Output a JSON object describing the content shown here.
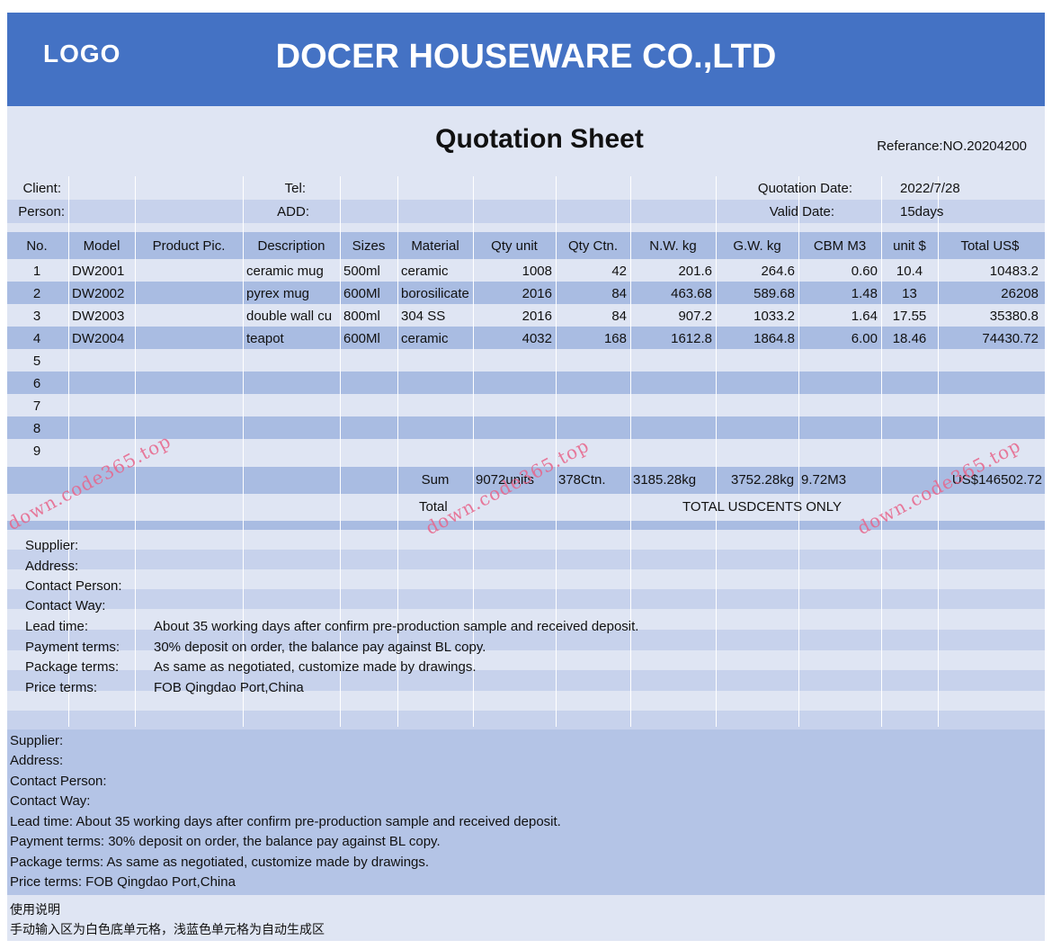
{
  "header": {
    "logo": "LOGO",
    "company": "DOCER HOUSEWARE CO.,LTD"
  },
  "title": "Quotation Sheet",
  "reference": "Referance:NO.20204200",
  "client_info": {
    "client_label": "Client:",
    "tel_label": "Tel:",
    "quotation_date_label": "Quotation Date:",
    "quotation_date": "2022/7/28",
    "person_label": "Person:",
    "add_label": "ADD:",
    "valid_date_label": "Valid Date:",
    "valid_date": "15days"
  },
  "table": {
    "headers": [
      "No.",
      "Model",
      "Product Pic.",
      "Description",
      "Sizes",
      "Material",
      "Qty unit",
      "Qty Ctn.",
      "N.W. kg",
      "G.W. kg",
      "CBM M3",
      "unit $",
      "Total US$"
    ],
    "rows": [
      [
        "1",
        "DW2001",
        "",
        "ceramic mug",
        "500ml",
        "ceramic",
        "1008",
        "42",
        "201.6",
        "264.6",
        "0.60",
        "10.4",
        "10483.2"
      ],
      [
        "2",
        "DW2002",
        "",
        "pyrex mug",
        "600Ml",
        "borosilicate",
        "2016",
        "84",
        "463.68",
        "589.68",
        "1.48",
        "13",
        "26208"
      ],
      [
        "3",
        "DW2003",
        "",
        "double wall cu",
        "800ml",
        "304 SS",
        "2016",
        "84",
        "907.2",
        "1033.2",
        "1.64",
        "17.55",
        "35380.8"
      ],
      [
        "4",
        "DW2004",
        "",
        "teapot",
        "600Ml",
        "ceramic",
        "4032",
        "168",
        "1612.8",
        "1864.8",
        "6.00",
        "18.46",
        "74430.72"
      ],
      [
        "5",
        "",
        "",
        "",
        "",
        "",
        "",
        "",
        "",
        "",
        "",
        "",
        ""
      ],
      [
        "6",
        "",
        "",
        "",
        "",
        "",
        "",
        "",
        "",
        "",
        "",
        "",
        ""
      ],
      [
        "7",
        "",
        "",
        "",
        "",
        "",
        "",
        "",
        "",
        "",
        "",
        "",
        ""
      ],
      [
        "8",
        "",
        "",
        "",
        "",
        "",
        "",
        "",
        "",
        "",
        "",
        "",
        ""
      ],
      [
        "9",
        "",
        "",
        "",
        "",
        "",
        "",
        "",
        "",
        "",
        "",
        "",
        ""
      ]
    ],
    "sum": {
      "label": "Sum",
      "qty_unit": "9072units",
      "qty_ctn": "378Ctn.",
      "nw": "3185.28kg",
      "gw": "3752.28kg",
      "cbm": "9.72M3",
      "total": "US$146502.72"
    },
    "total": {
      "label": "Total",
      "text": "TOTAL USDCENTS ONLY"
    }
  },
  "terms": {
    "supplier_label": "Supplier:",
    "address_label": "Address:",
    "contact_person_label": "Contact Person:",
    "contact_way_label": "Contact Way:",
    "lead_time_label": "Lead time:",
    "lead_time": "About 35 working days after confirm pre-production sample and received deposit.",
    "payment_label": "Payment terms:",
    "payment": "30% deposit on order, the balance pay against BL copy.",
    "package_label": "Package terms:",
    "package": "As same as negotiated, customize made by drawings.",
    "price_label": "Price terms:",
    "price": "FOB Qingdao Port,China"
  },
  "notes": [
    "Supplier:",
    "Address:",
    "Contact Person:",
    "Contact Way:",
    "Lead time: About 35 working days after confirm pre-production sample and received deposit.",
    "Payment terms: 30% deposit on order, the balance pay against BL copy.",
    "Package terms: As same as negotiated, customize made by drawings.",
    "Price terms: FOB Qingdao Port,China"
  ],
  "usage": [
    "使用说明",
    "手动输入区为白色底单元格，浅蓝色单元格为自动生成区"
  ],
  "watermark": "down.code365.top",
  "colors": {
    "banner": "#4472c4",
    "band_dark": "#a9bce2",
    "band_mid": "#c7d2ec",
    "band_light": "#dfe5f3",
    "watermark": "#e8648a"
  }
}
